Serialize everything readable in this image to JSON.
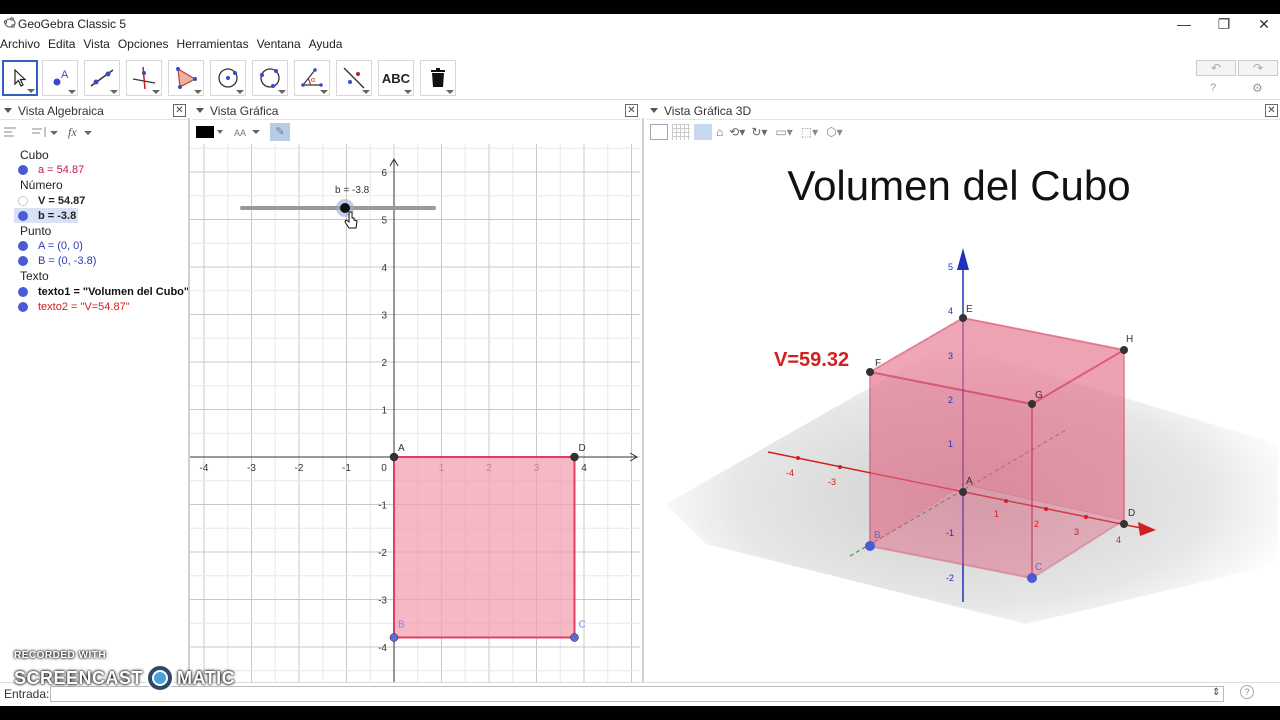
{
  "window": {
    "title": "GeoGebra Classic 5",
    "controls": [
      "—",
      "❐",
      "✕"
    ]
  },
  "menu": [
    "Archivo",
    "Edita",
    "Vista",
    "Opciones",
    "Herramientas",
    "Ventana",
    "Ayuda"
  ],
  "toolbar": {
    "tools": [
      {
        "name": "move",
        "label": ""
      },
      {
        "name": "point",
        "label": ""
      },
      {
        "name": "line",
        "label": ""
      },
      {
        "name": "perpendicular",
        "label": ""
      },
      {
        "name": "polygon",
        "label": ""
      },
      {
        "name": "circle-center",
        "label": ""
      },
      {
        "name": "circle-three",
        "label": ""
      },
      {
        "name": "angle",
        "label": ""
      },
      {
        "name": "reflect",
        "label": ""
      },
      {
        "name": "text",
        "label": "ABC"
      },
      {
        "name": "delete",
        "label": ""
      }
    ],
    "undo": "↶",
    "redo": "↷"
  },
  "panels": {
    "algebra": "Vista Algebraica",
    "graphics": "Vista Gráfica",
    "graphics3d": "Vista Gráfica 3D",
    "close": "✕"
  },
  "algebra": {
    "groups": [
      {
        "name": "Cubo",
        "items": [
          {
            "text": "a = 54.87",
            "color": "#c0204a",
            "bold": false,
            "dot": "#4a5ad8"
          }
        ]
      },
      {
        "name": "Número",
        "items": [
          {
            "text": "V = 54.87",
            "color": "#222222",
            "bold": true,
            "dot": "hollow"
          },
          {
            "text": "b = -3.8",
            "color": "#222222",
            "bold": true,
            "dot": "#4a5ad8",
            "selected": true
          }
        ]
      },
      {
        "name": "Punto",
        "items": [
          {
            "text": "A = (0, 0)",
            "color": "#2a3ab0",
            "bold": false,
            "dot": "#4a5ad8"
          },
          {
            "text": "B = (0, -3.8)",
            "color": "#2a3ab0",
            "bold": false,
            "dot": "#4a5ad8"
          }
        ]
      },
      {
        "name": "Texto",
        "items": [
          {
            "text": "texto1 = \"Volumen del Cubo\"",
            "color": "#111111",
            "bold": true,
            "dot": "#4a5ad8"
          },
          {
            "text": "texto2 = \"V=54.87\"",
            "color": "#d02020",
            "bold": false,
            "dot": "#4a5ad8"
          }
        ]
      }
    ]
  },
  "graphics": {
    "slider_label": "b = -3.8",
    "slider_value": -3.8,
    "slider_min": -5,
    "slider_max": 5,
    "x_ticks": [
      "-4",
      "-3",
      "-2",
      "-1",
      "0",
      "1",
      "2",
      "3",
      "4"
    ],
    "y_ticks": [
      "6",
      "5",
      "4",
      "3",
      "2",
      "1",
      "-1",
      "-2",
      "-3",
      "-4"
    ],
    "square": {
      "x": [
        0,
        3.8
      ],
      "y": [
        -3.8,
        0
      ]
    },
    "points": [
      {
        "label": "A",
        "x": 0,
        "y": 0,
        "color": "#333333"
      },
      {
        "label": "D",
        "x": 3.8,
        "y": 0,
        "color": "#333333"
      },
      {
        "label": "B",
        "x": 0,
        "y": -3.8,
        "color": "#5a6ad8"
      },
      {
        "label": "C",
        "x": 3.8,
        "y": -3.8,
        "color": "#5a6ad8"
      }
    ],
    "fill": "#f2a0b0",
    "stroke": "#e04060"
  },
  "view3d": {
    "title": "Volumen del Cubo",
    "volume_text": "V=59.32",
    "z_ticks": [
      "5",
      "4",
      "3",
      "2",
      "1",
      "-1",
      "-2"
    ],
    "x_ticks": [
      "-4",
      "-3",
      "1",
      "2",
      "3",
      "4"
    ],
    "vertices": [
      "E",
      "H",
      "F",
      "G",
      "A",
      "B",
      "C",
      "D"
    ]
  },
  "inputbar": {
    "label": "Entrada:"
  },
  "watermark": {
    "line1": "RECORDED WITH",
    "line2a": "SCREENCAST",
    "line2b": "MATIC"
  }
}
